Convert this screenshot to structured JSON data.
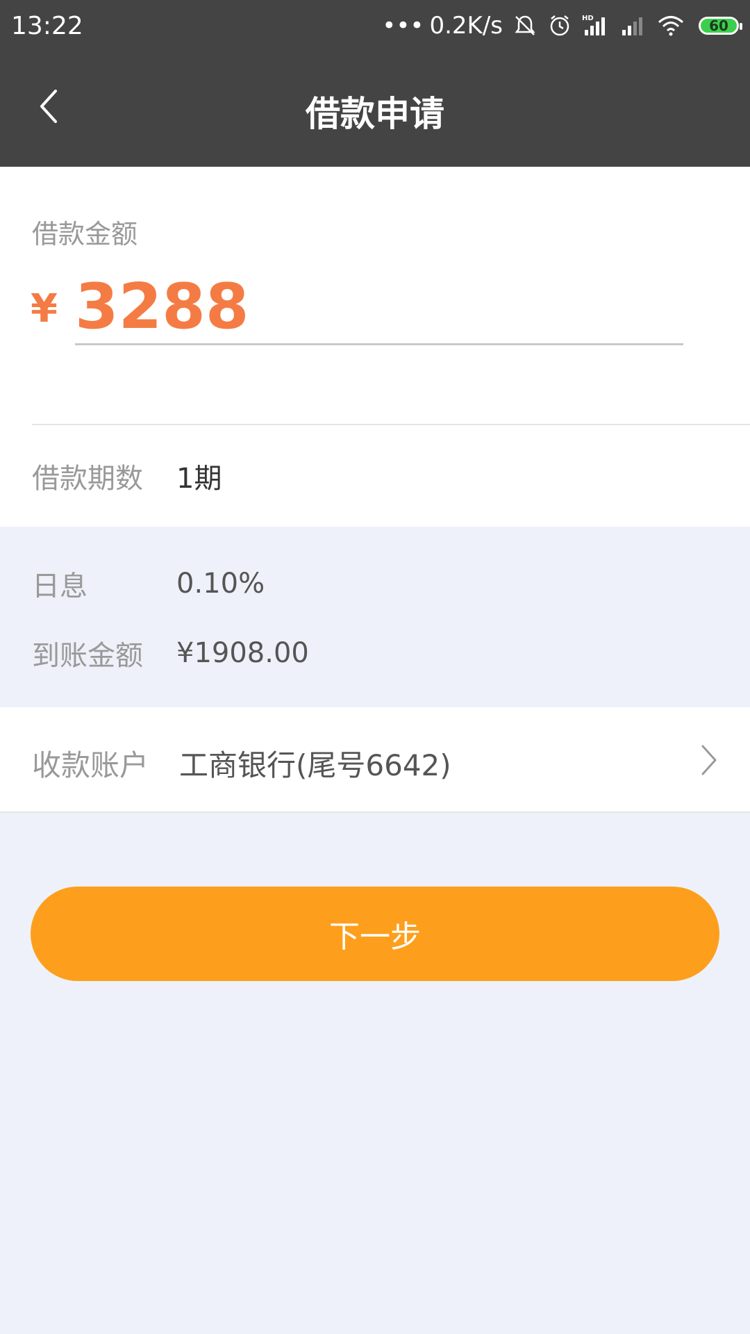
{
  "status_bar": {
    "time": "13:22",
    "dots": "•••",
    "network_speed": "0.2K/s",
    "battery": "60",
    "icons": [
      "mute-icon",
      "alarm-icon",
      "hd-signal-icon",
      "signal-icon",
      "wifi-icon",
      "battery-icon"
    ]
  },
  "header": {
    "title": "借款申请",
    "back_icon": "chevron-left-icon"
  },
  "amount": {
    "label": "借款金额",
    "currency": "¥",
    "value": "3288"
  },
  "period": {
    "label": "借款期数",
    "value": "1期"
  },
  "info": {
    "daily_interest_label": "日息",
    "daily_interest_value": "0.10%",
    "received_label": "到账金额",
    "received_value": "¥1908.00"
  },
  "account": {
    "label": "收款账户",
    "value": "工商银行(尾号6642)",
    "chevron_icon": "chevron-right-icon"
  },
  "next_button": {
    "label": "下一步"
  },
  "colors": {
    "header_bg": "#444444",
    "accent_orange": "#f47c44",
    "button_orange": "#fd9f1c",
    "page_bg": "#eef1f9"
  }
}
